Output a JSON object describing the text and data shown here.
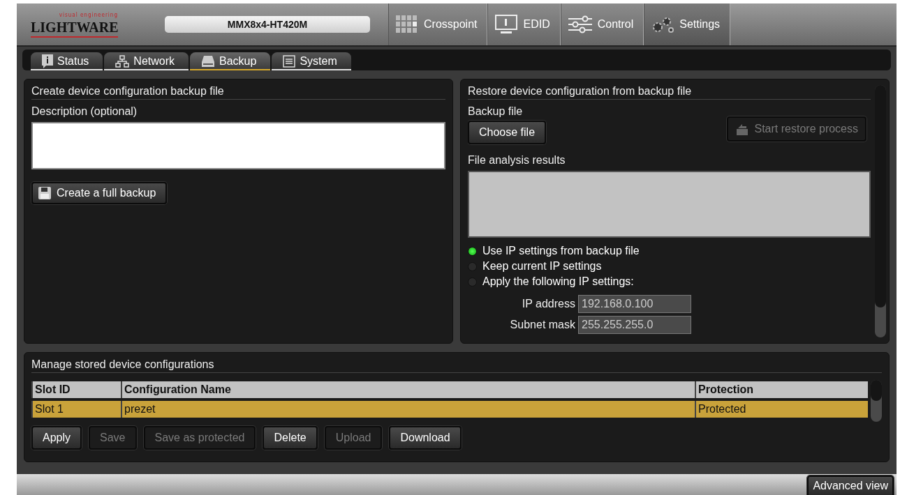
{
  "header": {
    "logo_tagline": "visual engineering",
    "logo": "LIGHTWARE",
    "device_name": "MMX8x4-HT420M",
    "tabs": [
      {
        "label": "Crosspoint",
        "selected": false
      },
      {
        "label": "EDID",
        "selected": false
      },
      {
        "label": "Control",
        "selected": false
      },
      {
        "label": "Settings",
        "selected": true
      }
    ]
  },
  "subtabs": [
    {
      "label": "Status",
      "selected": false
    },
    {
      "label": "Network",
      "selected": false
    },
    {
      "label": "Backup",
      "selected": true
    },
    {
      "label": "System",
      "selected": false
    }
  ],
  "backup_panel": {
    "title": "Create device configuration backup file",
    "description_label": "Description (optional)",
    "button": "Create a full backup"
  },
  "restore_panel": {
    "title": "Restore device configuration from backup file",
    "file_label": "Backup file",
    "choose_button": "Choose file",
    "start_button": {
      "label": "Start restore process",
      "disabled": true
    },
    "analysis_label": "File analysis results",
    "ip_options": [
      {
        "label": "Use IP settings from backup file",
        "selected": true
      },
      {
        "label": "Keep current IP settings",
        "selected": false
      },
      {
        "label": "Apply the following IP settings:",
        "selected": false
      }
    ],
    "fields": [
      {
        "label": "IP address",
        "value": "192.168.0.100"
      },
      {
        "label": "Subnet mask",
        "value": "255.255.255.0"
      }
    ]
  },
  "manage_panel": {
    "title": "Manage stored device configurations",
    "columns": [
      "Slot ID",
      "Configuration Name",
      "Protection"
    ],
    "rows": [
      {
        "cells": [
          "Slot 1",
          "prezet",
          "Protected"
        ],
        "selected": true
      }
    ],
    "buttons": [
      {
        "label": "Apply",
        "disabled": false
      },
      {
        "label": "Save",
        "disabled": true
      },
      {
        "label": "Save as protected",
        "disabled": true
      },
      {
        "label": "Delete",
        "disabled": false
      },
      {
        "label": "Upload",
        "disabled": true
      },
      {
        "label": "Download",
        "disabled": false
      }
    ]
  },
  "footer": {
    "button": "Advanced view"
  }
}
